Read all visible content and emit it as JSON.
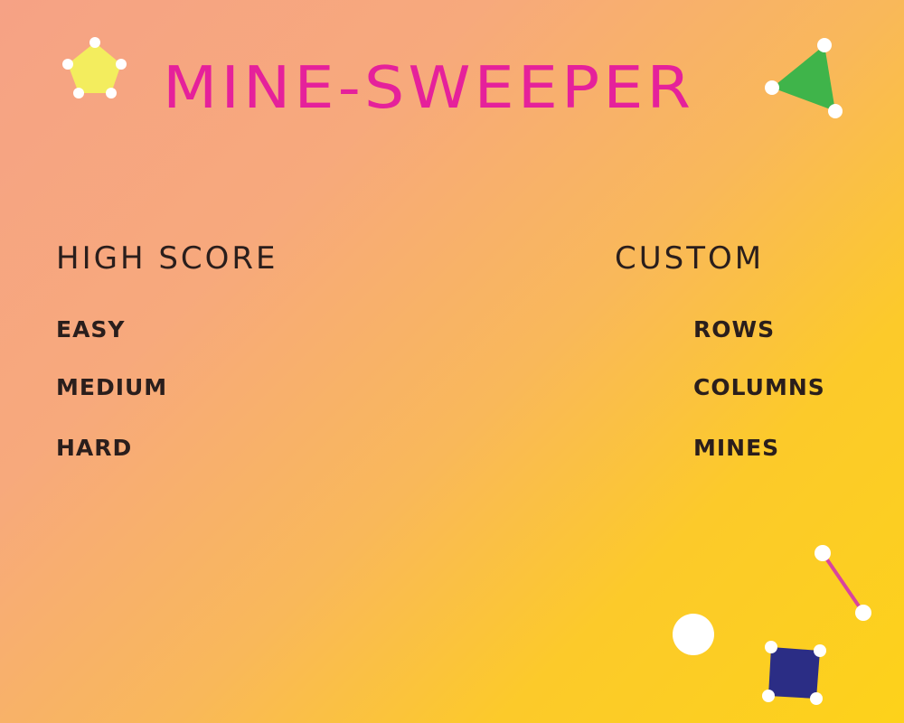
{
  "title": "Mine-sweeper",
  "high_score": {
    "heading": "High score",
    "levels": [
      {
        "label": "Easy"
      },
      {
        "label": "Medium"
      },
      {
        "label": "Hard"
      }
    ]
  },
  "custom": {
    "heading": "Custom",
    "options": [
      {
        "label": "Rows"
      },
      {
        "label": "Columns"
      },
      {
        "label": "Mines"
      }
    ]
  },
  "colors": {
    "title": "#e5219b",
    "text": "#2a1e1c",
    "pentagon": "#f3ed5e",
    "triangle": "#3fb44a",
    "square": "#2b2d85",
    "link": "#d9449e",
    "dot": "#ffffff"
  },
  "decorations": [
    "pentagon-icon",
    "triangle-icon",
    "segment-icon",
    "circle-icon",
    "square-icon"
  ]
}
